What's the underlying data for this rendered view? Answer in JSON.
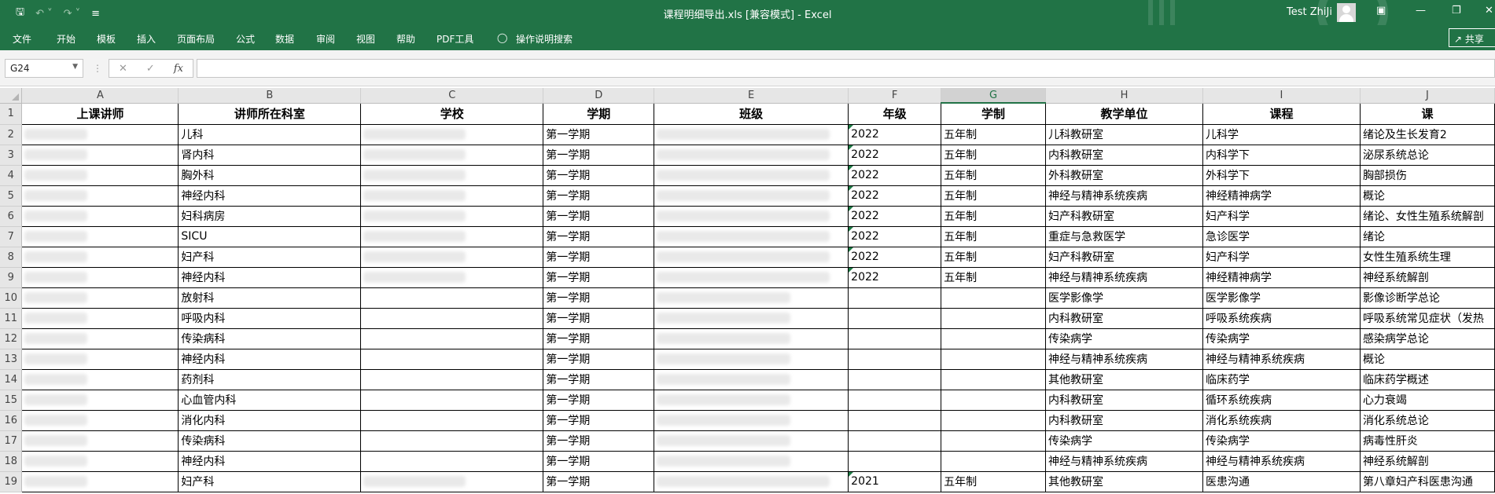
{
  "app": {
    "title": "课程明细导出.xls  [兼容模式]  -  Excel",
    "user": "Test ZhiJi"
  },
  "ribbon": {
    "tabs": [
      "文件",
      "开始",
      "模板",
      "插入",
      "页面布局",
      "公式",
      "数据",
      "审阅",
      "视图",
      "帮助",
      "PDF工具",
      "操作说明搜索"
    ],
    "share": "共享"
  },
  "formula_bar": {
    "name_box": "G24",
    "fx": "fx",
    "value": ""
  },
  "columns": [
    "A",
    "B",
    "C",
    "D",
    "E",
    "F",
    "G",
    "H",
    "I",
    "J"
  ],
  "selected_column": "G",
  "headers": [
    "上课讲师",
    "讲师所在科室",
    "学校",
    "学期",
    "班级",
    "年级",
    "学制",
    "教学单位",
    "课程",
    "课"
  ],
  "rows": [
    {
      "num": "2",
      "dept": "儿科",
      "term": "第一学期",
      "grade": "2022",
      "system": "五年制",
      "unit": "儿科教研室",
      "course": "儿科学",
      "topic": "绪论及生长发育2"
    },
    {
      "num": "3",
      "dept": "肾内科",
      "term": "第一学期",
      "grade": "2022",
      "system": "五年制",
      "unit": "内科教研室",
      "course": "内科学下",
      "topic": "泌尿系统总论"
    },
    {
      "num": "4",
      "dept": "胸外科",
      "term": "第一学期",
      "grade": "2022",
      "system": "五年制",
      "unit": "外科教研室",
      "course": "外科学下",
      "topic": "胸部损伤"
    },
    {
      "num": "5",
      "dept": "神经内科",
      "term": "第一学期",
      "grade": "2022",
      "system": "五年制",
      "unit": "神经与精神系统疾病",
      "course": "神经精神病学",
      "topic": "概论"
    },
    {
      "num": "6",
      "dept": "妇科病房",
      "term": "第一学期",
      "grade": "2022",
      "system": "五年制",
      "unit": "妇产科教研室",
      "course": "妇产科学",
      "topic": "绪论、女性生殖系统解剖"
    },
    {
      "num": "7",
      "dept": "SICU",
      "term": "第一学期",
      "grade": "2022",
      "system": "五年制",
      "unit": "重症与急救医学",
      "course": "急诊医学",
      "topic": "绪论"
    },
    {
      "num": "8",
      "dept": "妇产科",
      "term": "第一学期",
      "grade": "2022",
      "system": "五年制",
      "unit": "妇产科教研室",
      "course": "妇产科学",
      "topic": "女性生殖系统生理"
    },
    {
      "num": "9",
      "dept": "神经内科",
      "term": "第一学期",
      "grade": "2022",
      "system": "五年制",
      "unit": "神经与精神系统疾病",
      "course": "神经精神病学",
      "topic": "神经系统解剖"
    },
    {
      "num": "10",
      "dept": "放射科",
      "term": "第一学期",
      "grade": "",
      "system": "",
      "unit": "医学影像学",
      "course": "医学影像学",
      "topic": "影像诊断学总论"
    },
    {
      "num": "11",
      "dept": "呼吸内科",
      "term": "第一学期",
      "grade": "",
      "system": "",
      "unit": "内科教研室",
      "course": "呼吸系统疾病",
      "topic": "呼吸系统常见症状（发热"
    },
    {
      "num": "12",
      "dept": "传染病科",
      "term": "第一学期",
      "grade": "",
      "system": "",
      "unit": "传染病学",
      "course": "传染病学",
      "topic": "感染病学总论"
    },
    {
      "num": "13",
      "dept": "神经内科",
      "term": "第一学期",
      "grade": "",
      "system": "",
      "unit": "神经与精神系统疾病",
      "course": "神经与精神系统疾病",
      "topic": "概论"
    },
    {
      "num": "14",
      "dept": "药剂科",
      "term": "第一学期",
      "grade": "",
      "system": "",
      "unit": "其他教研室",
      "course": "临床药学",
      "topic": "临床药学概述"
    },
    {
      "num": "15",
      "dept": "心血管内科",
      "term": "第一学期",
      "grade": "",
      "system": "",
      "unit": "内科教研室",
      "course": "循环系统疾病",
      "topic": "心力衰竭"
    },
    {
      "num": "16",
      "dept": "消化内科",
      "term": "第一学期",
      "grade": "",
      "system": "",
      "unit": "内科教研室",
      "course": "消化系统疾病",
      "topic": "消化系统总论"
    },
    {
      "num": "17",
      "dept": "传染病科",
      "term": "第一学期",
      "grade": "",
      "system": "",
      "unit": "传染病学",
      "course": "传染病学",
      "topic": "病毒性肝炎"
    },
    {
      "num": "18",
      "dept": "神经内科",
      "term": "第一学期",
      "grade": "",
      "system": "",
      "unit": "神经与精神系统疾病",
      "course": "神经与精神系统疾病",
      "topic": "神经系统解剖"
    },
    {
      "num": "19",
      "dept": "妇产科",
      "term": "第一学期",
      "grade": "2021",
      "system": "五年制",
      "unit": "其他教研室",
      "course": "医患沟通",
      "topic": "第八章妇产科医患沟通"
    }
  ]
}
